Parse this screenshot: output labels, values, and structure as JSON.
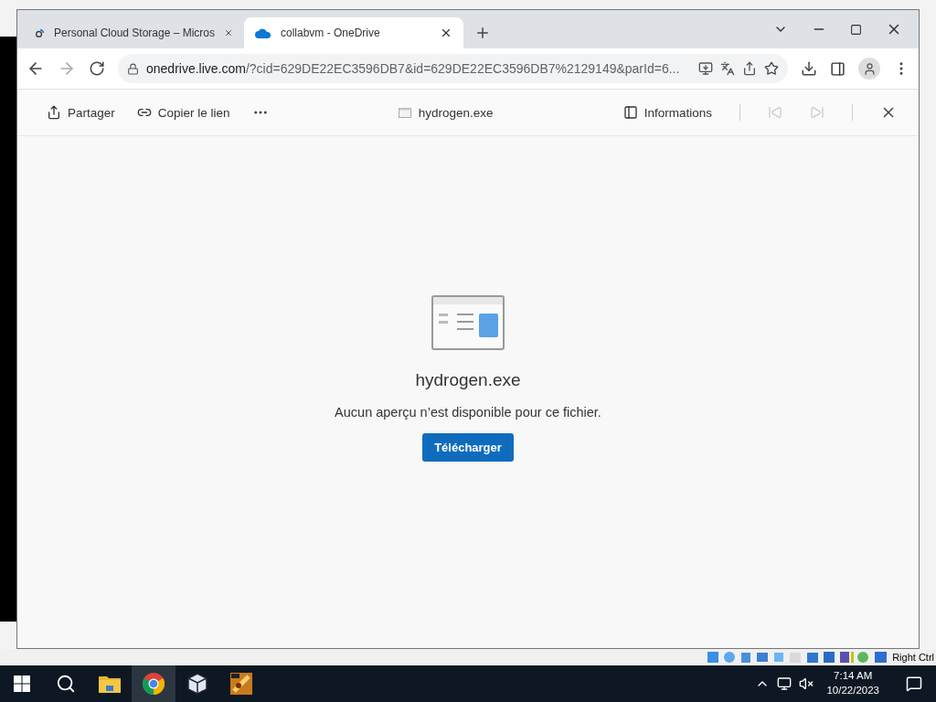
{
  "browser": {
    "tabs": [
      {
        "title": "Personal Cloud Storage – Micros",
        "kind": "cloud-storage",
        "selected": false
      },
      {
        "title": "collabvm - OneDrive",
        "kind": "onedrive",
        "selected": true
      }
    ],
    "address": {
      "domain": "onedrive.live.com",
      "path": "/?cid=629DE22EC3596DB7&id=629DE22EC3596DB7%2129149&parId=6..."
    }
  },
  "viewer": {
    "actions": [
      {
        "kind": "share",
        "label": "Partager"
      },
      {
        "kind": "link",
        "label": "Copier le lien"
      }
    ],
    "file_name": "hydrogen.exe",
    "info": "Informations"
  },
  "preview": {
    "file_name": "hydrogen.exe",
    "message": "Aucun aperçu n’est disponible pour ce fichier.",
    "button": "Télécharger"
  },
  "vbox_status": {
    "host_key": "Right Ctrl"
  },
  "taskbar": {
    "apps": [
      {
        "kind": "explorer",
        "selected": false
      },
      {
        "kind": "chrome",
        "selected": true
      },
      {
        "kind": "virtualbox",
        "selected": false
      },
      {
        "kind": "app",
        "selected": false
      }
    ],
    "time": "7:14 AM",
    "date": "10/22/2023"
  }
}
